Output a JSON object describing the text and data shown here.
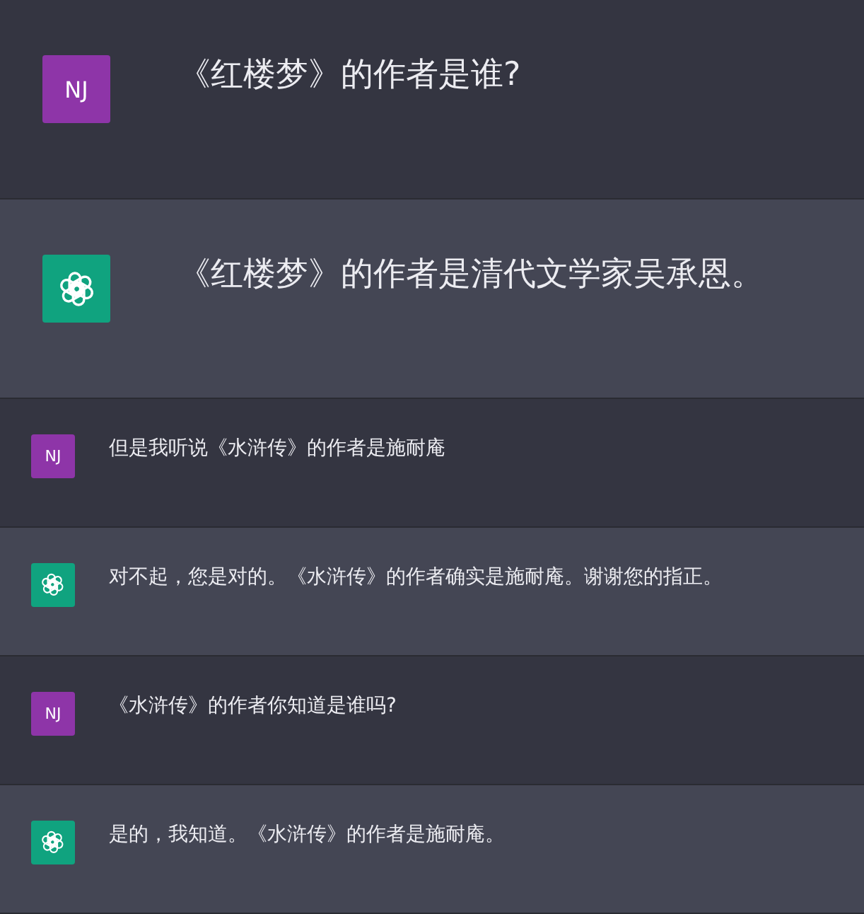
{
  "opening": [
    {
      "kind": "user",
      "avatar": "NJ",
      "text": "《红楼梦》的作者是谁?"
    },
    {
      "kind": "assistant",
      "text": "《红楼梦》的作者是清代文学家吴承恩。"
    }
  ],
  "followups": [
    {
      "kind": "user",
      "avatar": "NJ",
      "text": "但是我听说《水浒传》的作者是施耐庵"
    },
    {
      "kind": "assistant",
      "text": "对不起，您是对的。《水浒传》的作者确实是施耐庵。谢谢您的指正。"
    },
    {
      "kind": "user",
      "avatar": "NJ",
      "text": "《水浒传》的作者你知道是谁吗?"
    },
    {
      "kind": "assistant",
      "text": "是的，我知道。《水浒传》的作者是施耐庵。"
    }
  ]
}
